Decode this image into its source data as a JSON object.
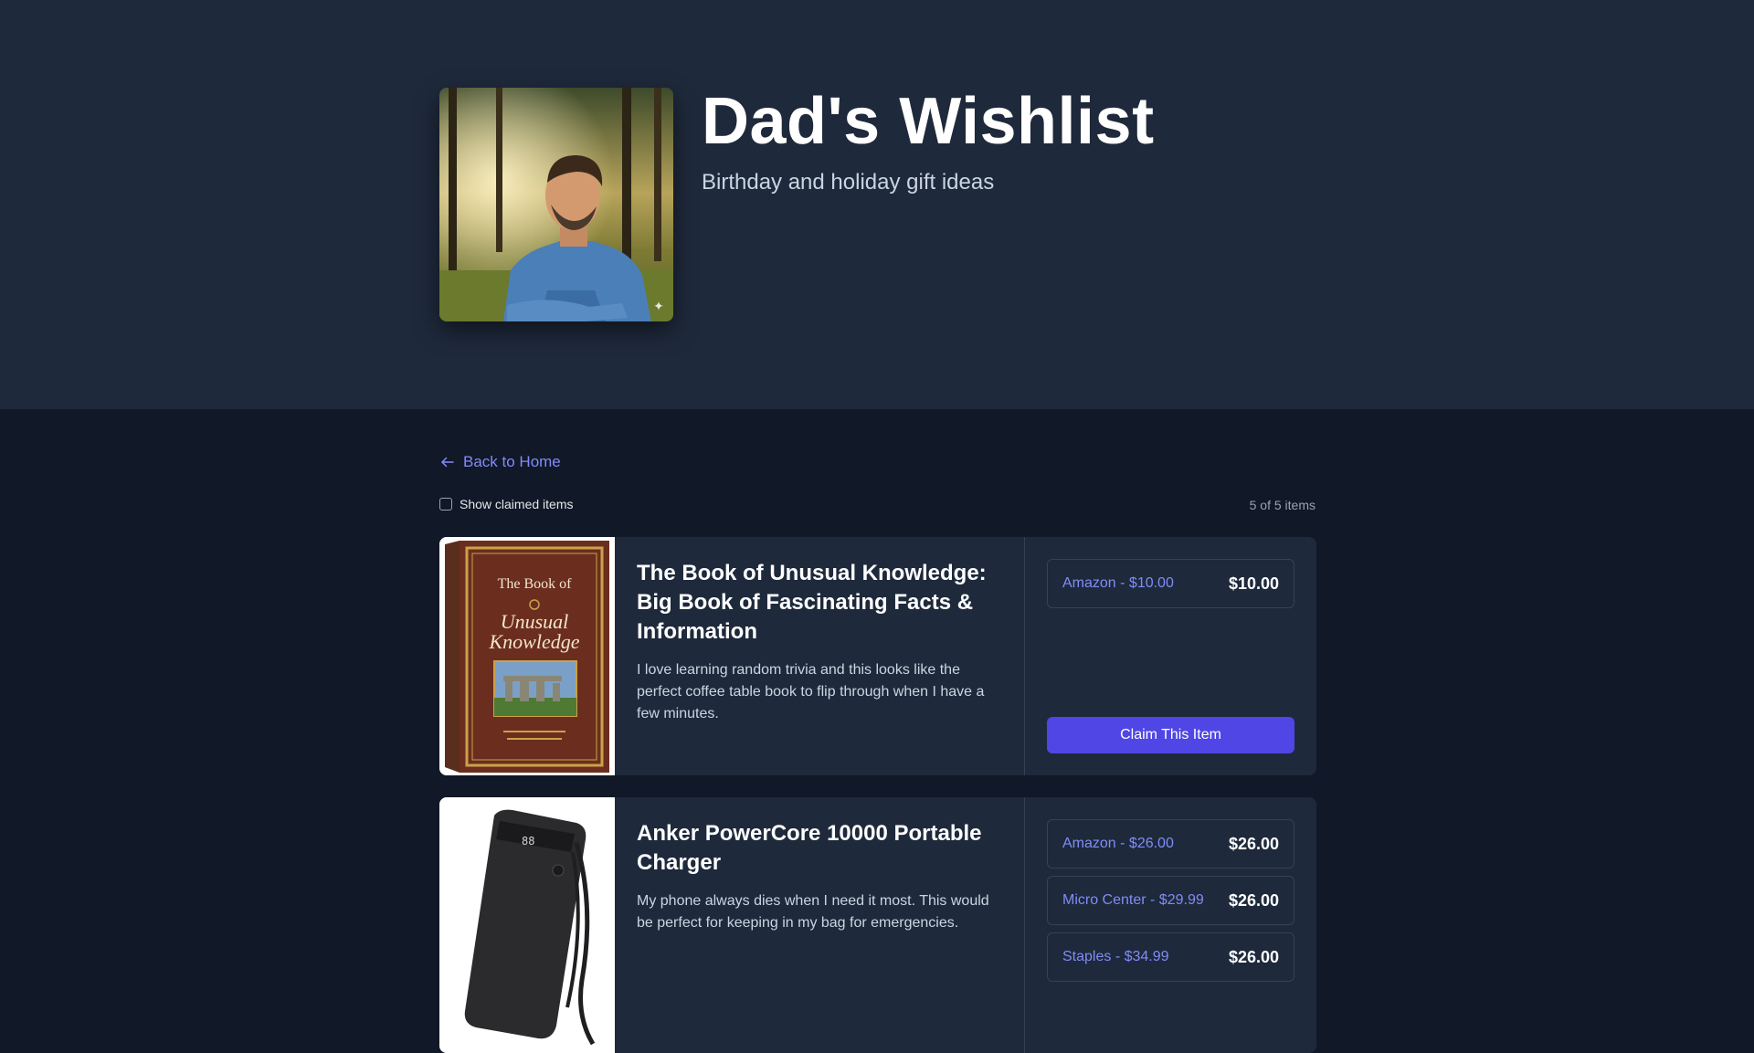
{
  "header": {
    "title": "Dad's Wishlist",
    "subtitle": "Birthday and holiday gift ideas"
  },
  "nav": {
    "back_label": "Back to Home"
  },
  "filter": {
    "show_claimed_label": "Show claimed items",
    "show_claimed_checked": false,
    "count_text": "5 of 5 items"
  },
  "items": [
    {
      "title": "The Book of Unusual Knowledge: Big Book of Fascinating Facts & Information",
      "description": "I love learning random trivia and this looks like the perfect coffee table book to flip through when I have a few minutes.",
      "cover_lines": [
        "The Book of",
        "Unusual",
        "Knowledge"
      ],
      "prices": [
        {
          "store": "Amazon - $10.00",
          "price": "$10.00"
        }
      ],
      "claim_label": "Claim This Item"
    },
    {
      "title": "Anker PowerCore 10000 Portable Charger",
      "description": "My phone always dies when I need it most. This would be perfect for keeping in my bag for emergencies.",
      "device_screen": "88",
      "prices": [
        {
          "store": "Amazon - $26.00",
          "price": "$26.00"
        },
        {
          "store": "Micro Center - $29.99",
          "price": "$26.00"
        },
        {
          "store": "Staples - $34.99",
          "price": "$26.00"
        }
      ]
    }
  ],
  "colors": {
    "header_bg": "#1e293b",
    "page_bg": "#111827",
    "accent": "#4f46e5",
    "link": "#818cf8"
  },
  "icons": {
    "back": "arrow-left-icon",
    "avatar_badge": "sparkle-icon"
  }
}
